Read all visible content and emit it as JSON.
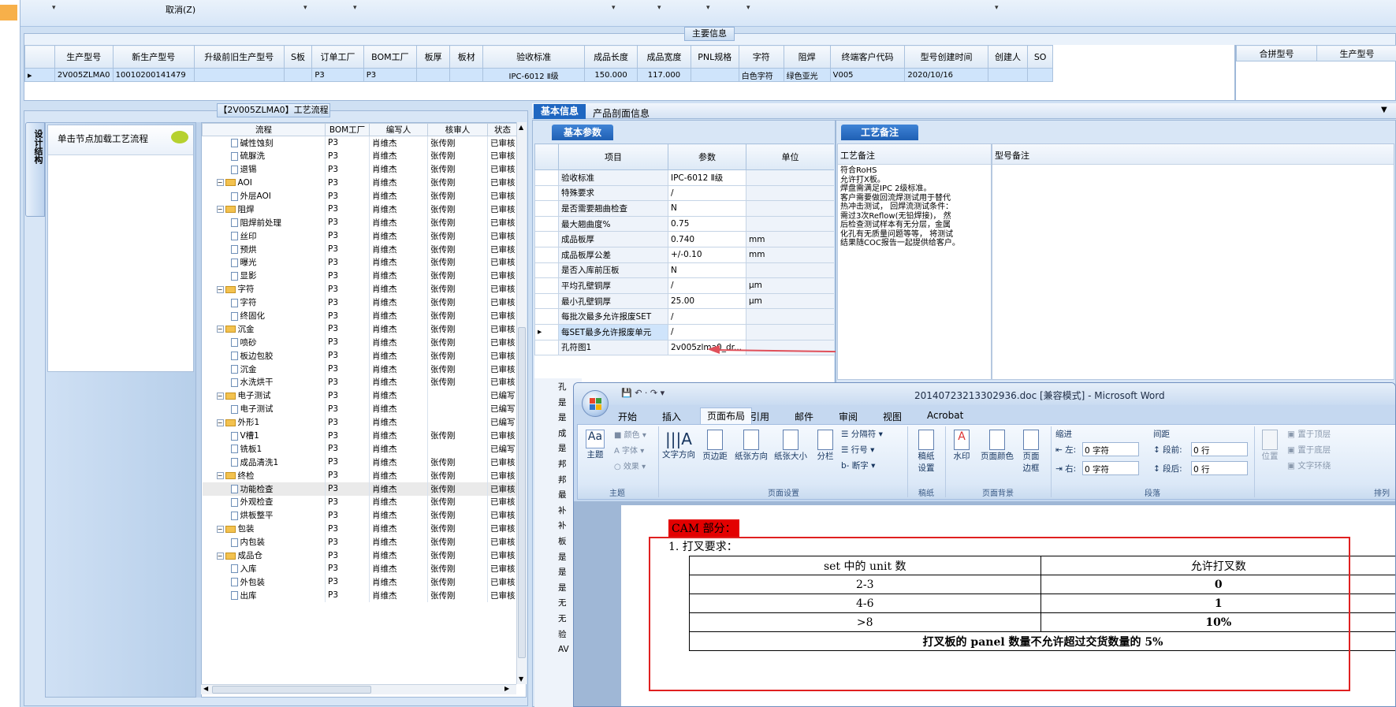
{
  "toolbar": {
    "cancel_label": "取消(Z)"
  },
  "main_info": {
    "title": "主要信息",
    "columns": [
      "生产型号",
      "新生产型号",
      "升级前旧生产型号",
      "S板",
      "订单工厂",
      "BOM工厂",
      "板厚",
      "板材",
      "验收标准",
      "成品长度",
      "成品宽度",
      "PNL规格",
      "字符",
      "阻焊",
      "终端客户代码",
      "型号创建时间",
      "创建人",
      "SO"
    ],
    "row": [
      "2V005ZLMA0",
      "10010200141479",
      "",
      "",
      "P3",
      "P3",
      "",
      "",
      "IPC-6012 Ⅱ级",
      "150.000",
      "117.000",
      "",
      "白色字符",
      "绿色亚光",
      "V005",
      "2020/10/16",
      "",
      ""
    ],
    "side_columns": [
      "合拼型号",
      "生产型号"
    ]
  },
  "process": {
    "title": "【2V005ZLMA0】工艺流程",
    "side_tab": "设计结构",
    "load_hint": "单击节点加载工艺流程",
    "columns": [
      "流程",
      "BOM工厂",
      "编写人",
      "核审人",
      "状态"
    ],
    "rows": [
      {
        "name": "碱性蚀刻",
        "level": 2,
        "type": "doc",
        "bom": "P3",
        "writer": "肖维杰",
        "reviewer": "张传刚",
        "status": "已审核"
      },
      {
        "name": "硫脲洗",
        "level": 2,
        "type": "doc",
        "bom": "P3",
        "writer": "肖维杰",
        "reviewer": "张传刚",
        "status": "已审核"
      },
      {
        "name": "退锡",
        "level": 2,
        "type": "doc",
        "bom": "P3",
        "writer": "肖维杰",
        "reviewer": "张传刚",
        "status": "已审核"
      },
      {
        "name": "AOI",
        "level": 1,
        "type": "folder",
        "bom": "P3",
        "writer": "肖维杰",
        "reviewer": "张传刚",
        "status": "已审核"
      },
      {
        "name": "外层AOI",
        "level": 2,
        "type": "doc",
        "bom": "P3",
        "writer": "肖维杰",
        "reviewer": "张传刚",
        "status": "已审核"
      },
      {
        "name": "阻焊",
        "level": 1,
        "type": "folder",
        "bom": "P3",
        "writer": "肖维杰",
        "reviewer": "张传刚",
        "status": "已审核"
      },
      {
        "name": "阻焊前处理",
        "level": 2,
        "type": "doc",
        "bom": "P3",
        "writer": "肖维杰",
        "reviewer": "张传刚",
        "status": "已审核"
      },
      {
        "name": "丝印",
        "level": 2,
        "type": "doc",
        "bom": "P3",
        "writer": "肖维杰",
        "reviewer": "张传刚",
        "status": "已审核"
      },
      {
        "name": "预烘",
        "level": 2,
        "type": "doc",
        "bom": "P3",
        "writer": "肖维杰",
        "reviewer": "张传刚",
        "status": "已审核"
      },
      {
        "name": "曝光",
        "level": 2,
        "type": "doc",
        "bom": "P3",
        "writer": "肖维杰",
        "reviewer": "张传刚",
        "status": "已审核"
      },
      {
        "name": "显影",
        "level": 2,
        "type": "doc",
        "bom": "P3",
        "writer": "肖维杰",
        "reviewer": "张传刚",
        "status": "已审核"
      },
      {
        "name": "字符",
        "level": 1,
        "type": "folder",
        "bom": "P3",
        "writer": "肖维杰",
        "reviewer": "张传刚",
        "status": "已审核"
      },
      {
        "name": "字符",
        "level": 2,
        "type": "doc",
        "bom": "P3",
        "writer": "肖维杰",
        "reviewer": "张传刚",
        "status": "已审核"
      },
      {
        "name": "终固化",
        "level": 2,
        "type": "doc",
        "bom": "P3",
        "writer": "肖维杰",
        "reviewer": "张传刚",
        "status": "已审核"
      },
      {
        "name": "沉金",
        "level": 1,
        "type": "folder",
        "bom": "P3",
        "writer": "肖维杰",
        "reviewer": "张传刚",
        "status": "已审核"
      },
      {
        "name": "喷砂",
        "level": 2,
        "type": "doc",
        "bom": "P3",
        "writer": "肖维杰",
        "reviewer": "张传刚",
        "status": "已审核"
      },
      {
        "name": "板边包胶",
        "level": 2,
        "type": "doc",
        "bom": "P3",
        "writer": "肖维杰",
        "reviewer": "张传刚",
        "status": "已审核"
      },
      {
        "name": "沉金",
        "level": 2,
        "type": "doc",
        "bom": "P3",
        "writer": "肖维杰",
        "reviewer": "张传刚",
        "status": "已审核"
      },
      {
        "name": "水洗烘干",
        "level": 2,
        "type": "doc",
        "bom": "P3",
        "writer": "肖维杰",
        "reviewer": "张传刚",
        "status": "已审核"
      },
      {
        "name": "电子测试",
        "level": 1,
        "type": "folder",
        "bom": "P3",
        "writer": "肖维杰",
        "reviewer": "",
        "status": "已编写"
      },
      {
        "name": "电子测试",
        "level": 2,
        "type": "doc",
        "bom": "P3",
        "writer": "肖维杰",
        "reviewer": "",
        "status": "已编写"
      },
      {
        "name": "外形1",
        "level": 1,
        "type": "folder",
        "bom": "P3",
        "writer": "肖维杰",
        "reviewer": "",
        "status": "已编写"
      },
      {
        "name": "V槽1",
        "level": 2,
        "type": "doc",
        "bom": "P3",
        "writer": "肖维杰",
        "reviewer": "张传刚",
        "status": "已审核"
      },
      {
        "name": "铣板1",
        "level": 2,
        "type": "doc",
        "bom": "P3",
        "writer": "肖维杰",
        "reviewer": "",
        "status": "已编写"
      },
      {
        "name": "成品清洗1",
        "level": 2,
        "type": "doc",
        "bom": "P3",
        "writer": "肖维杰",
        "reviewer": "张传刚",
        "status": "已审核"
      },
      {
        "name": "终检",
        "level": 1,
        "type": "folder",
        "bom": "P3",
        "writer": "肖维杰",
        "reviewer": "张传刚",
        "status": "已审核"
      },
      {
        "name": "功能检查",
        "level": 2,
        "type": "doc",
        "bom": "P3",
        "writer": "肖维杰",
        "reviewer": "张传刚",
        "status": "已审核"
      },
      {
        "name": "外观检查",
        "level": 2,
        "type": "doc",
        "bom": "P3",
        "writer": "肖维杰",
        "reviewer": "张传刚",
        "status": "已审核"
      },
      {
        "name": "烘板整平",
        "level": 2,
        "type": "doc",
        "bom": "P3",
        "writer": "肖维杰",
        "reviewer": "张传刚",
        "status": "已审核"
      },
      {
        "name": "包装",
        "level": 1,
        "type": "folder",
        "bom": "P3",
        "writer": "肖维杰",
        "reviewer": "张传刚",
        "status": "已审核"
      },
      {
        "name": "内包装",
        "level": 2,
        "type": "doc",
        "bom": "P3",
        "writer": "肖维杰",
        "reviewer": "张传刚",
        "status": "已审核"
      },
      {
        "name": "成品仓",
        "level": 1,
        "type": "folder",
        "bom": "P3",
        "writer": "肖维杰",
        "reviewer": "张传刚",
        "status": "已审核"
      },
      {
        "name": "入库",
        "level": 2,
        "type": "doc",
        "bom": "P3",
        "writer": "肖维杰",
        "reviewer": "张传刚",
        "status": "已审核"
      },
      {
        "name": "外包装",
        "level": 2,
        "type": "doc",
        "bom": "P3",
        "writer": "肖维杰",
        "reviewer": "张传刚",
        "status": "已审核"
      },
      {
        "name": "出库",
        "level": 2,
        "type": "doc",
        "bom": "P3",
        "writer": "肖维杰",
        "reviewer": "张传刚",
        "status": "已审核"
      }
    ]
  },
  "info_tabs": {
    "basic": "基本信息",
    "profile": "产品剖面信息"
  },
  "basic_params": {
    "title": "基本参数",
    "columns": [
      "项目",
      "参数",
      "单位"
    ],
    "rows": [
      {
        "item": "验收标准",
        "value": "IPC-6012 Ⅱ级",
        "unit": ""
      },
      {
        "item": "特殊要求",
        "value": "/",
        "unit": ""
      },
      {
        "item": "是否需要翘曲检查",
        "value": "N",
        "unit": ""
      },
      {
        "item": "最大翘曲度%",
        "value": "0.75",
        "unit": ""
      },
      {
        "item": "成品板厚",
        "value": "0.740",
        "unit": "mm"
      },
      {
        "item": "成品板厚公差",
        "value": "+/-0.10",
        "unit": "mm"
      },
      {
        "item": "是否入库前压板",
        "value": "N",
        "unit": ""
      },
      {
        "item": "平均孔壁铜厚",
        "value": "/",
        "unit": "μm"
      },
      {
        "item": "最小孔壁铜厚",
        "value": "25.00",
        "unit": "μm"
      },
      {
        "item": "每批次最多允许报废SET",
        "value": "/",
        "unit": ""
      },
      {
        "item": "每SET最多允许报废单元",
        "value": "/",
        "unit": ""
      },
      {
        "item": "孔符图1",
        "value": "2v005zlma0_dr...",
        "unit": ""
      }
    ],
    "hidden_items": [
      "孔",
      "是",
      "是",
      "成",
      "是",
      "邦",
      "邦",
      "最",
      "补",
      "补",
      "板",
      "是",
      "是",
      "是",
      "无",
      "无",
      "验",
      "AV"
    ]
  },
  "process_notes": {
    "title": "工艺备注",
    "col1": "工艺备注",
    "col2": "型号备注",
    "text": [
      "符合RoHS",
      "允许打X板。",
      "焊盘需满足IPC 2级标准。",
      "客户需要做回流焊测试用于替代",
      "热冲击测试， 回焊流测试条件：",
      "需过3次Reflow(无铅焊接)， 然",
      "后检查测试样本有无分层，金属",
      "化孔有无质量问题等等， 将测试",
      "结果随COC报告一起提供给客户。"
    ]
  },
  "word": {
    "title": "20140723213302936.doc [兼容模式] - Microsoft Word",
    "tabs": [
      "开始",
      "插入",
      "页面布局",
      "引用",
      "邮件",
      "审阅",
      "视图",
      "Acrobat"
    ],
    "active_tab": "页面布局",
    "groups": {
      "theme": "主题",
      "page_setup": "页面设置",
      "draft": "稿纸",
      "background": "页面背景",
      "paragraph": "段落",
      "arrange": "排列"
    },
    "buttons": {
      "theme": "主题",
      "colors": "颜色",
      "fonts": "字体",
      "effects": "效果",
      "text_dir": "文字方向",
      "margins": "页边距",
      "orientation": "纸张方向",
      "size": "纸张大小",
      "columns": "分栏",
      "breaks": "分隔符",
      "line_numbers": "行号",
      "hyphen": "断字",
      "draft_setup": "稿纸设置",
      "watermark": "水印",
      "page_color": "页面颜色",
      "page_border": "页面边框",
      "position": "位置",
      "bring_front": "置于顶层",
      "send_back": "置于底层",
      "wrap": "文字环绕"
    },
    "indent": {
      "label": "缩进",
      "left_label": "左:",
      "left_value": "0 字符",
      "right_label": "右:",
      "right_value": "0 字符"
    },
    "spacing": {
      "label": "间距",
      "before_label": "段前:",
      "before_value": "0 行",
      "after_label": "段后:",
      "after_value": "0 行"
    },
    "doc": {
      "heading": "CAM 部分：",
      "item": "1.  打叉要求：",
      "table_headers": [
        "set 中的 unit 数",
        "允许打叉数"
      ],
      "table_rows": [
        [
          "2-3",
          "0"
        ],
        [
          "4-6",
          "1"
        ],
        [
          ">8",
          "10%"
        ]
      ],
      "footer": "打叉板的 panel 数量不允许超过交货数量的 5%"
    }
  }
}
